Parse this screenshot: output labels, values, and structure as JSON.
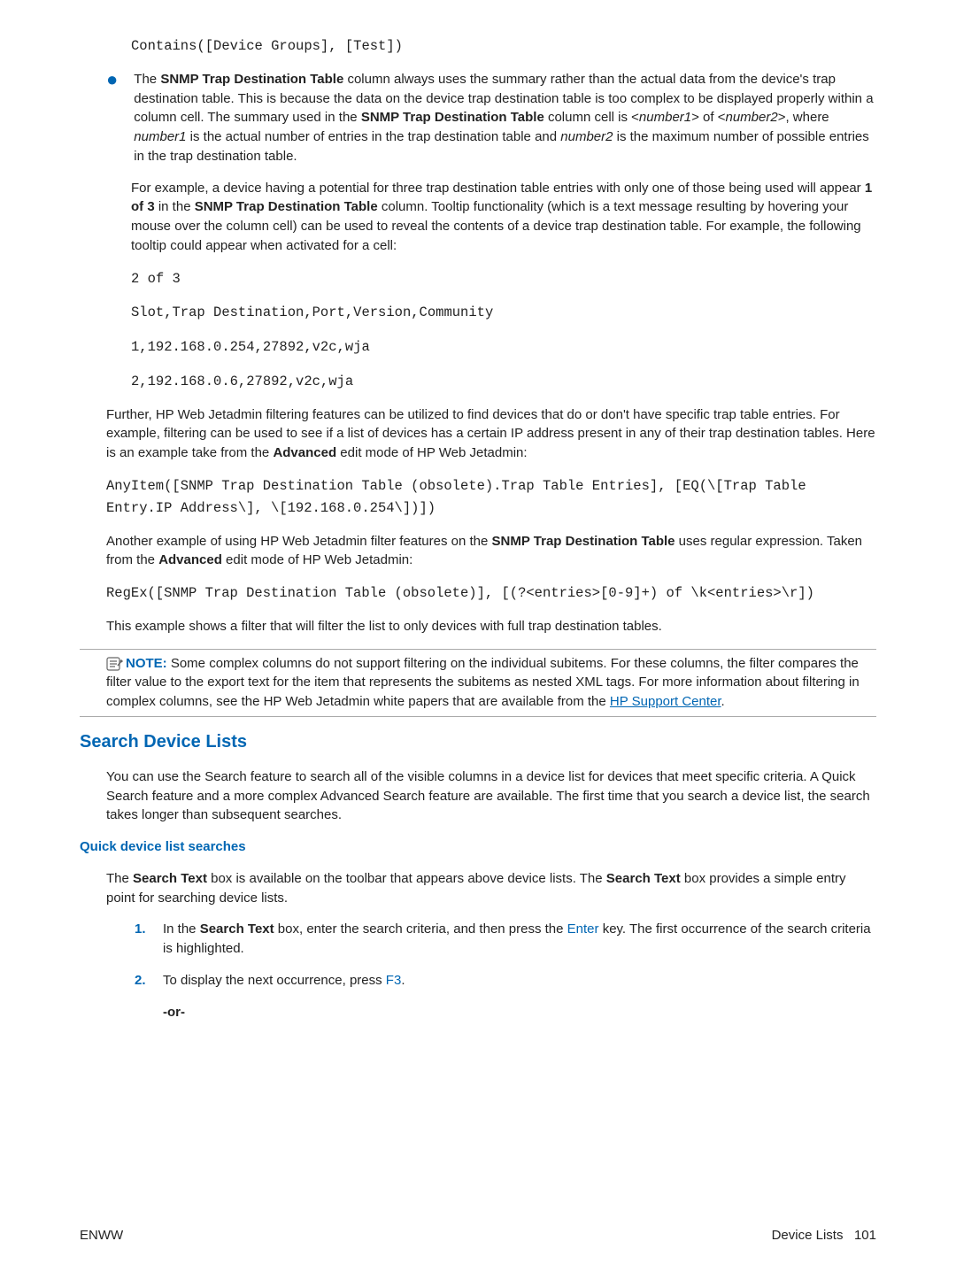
{
  "code_top": "Contains([Device Groups], [Test])",
  "bullet": {
    "p1a": "The ",
    "p1b": "SNMP Trap Destination Table",
    "p1c": " column always uses the summary rather than the actual data from the device's trap destination table. This is because the data on the device trap destination table is too complex to be displayed properly within a column cell. The summary used in the ",
    "p1d": "SNMP Trap Destination Table",
    "p1e": " column cell is <",
    "p1f": "number1",
    "p1g": "> of <",
    "p1h": "number2",
    "p1i": ">, where ",
    "p1j": "number1",
    "p1k": " is the actual number of entries in the trap destination table and ",
    "p1l": "number2",
    "p1m": " is the maximum number of possible entries in the trap destination table.",
    "p2a": "For example, a device having a potential for three trap destination table entries with only one of those being used will appear ",
    "p2b": "1 of 3",
    "p2c": " in the ",
    "p2d": "SNMP Trap Destination Table",
    "p2e": " column. Tooltip functionality (which is a text message resulting by hovering your mouse over the column cell) can be used to reveal the contents of a device trap destination table. For example, the following tooltip could appear when activated for a cell:"
  },
  "tooltip_code": {
    "l1": "2 of 3",
    "l2": "Slot,Trap Destination,Port,Version,Community",
    "l3": "1,192.168.0.254,27892,v2c,wja",
    "l4": "2,192.168.0.6,27892,v2c,wja"
  },
  "p_further": {
    "a": "Further, HP Web Jetadmin filtering features can be utilized to find devices that do or don't have specific trap table entries. For example, filtering can be used to see if a list of devices has a certain IP address present in any of their trap destination tables. Here is an example take from the ",
    "b": "Advanced",
    "c": " edit mode of HP Web Jetadmin:"
  },
  "code_anyitem": "AnyItem([SNMP Trap Destination Table (obsolete).Trap Table Entries], [EQ(\\[Trap Table Entry.IP Address\\], \\[192.168.0.254\\])])",
  "p_another": {
    "a": "Another example of using HP Web Jetadmin filter features on the ",
    "b": "SNMP Trap Destination Table",
    "c": " uses regular expression. Taken from the ",
    "d": "Advanced",
    "e": " edit mode of HP Web Jetadmin:"
  },
  "code_regex": "RegEx([SNMP Trap Destination Table (obsolete)], [(?<entries>[0-9]+) of \\k<entries>\\r])",
  "p_example": "This example shows a filter that will filter the list to only devices with full trap destination tables.",
  "note": {
    "label": "NOTE:",
    "text1": "   Some complex columns do not support filtering on the individual subitems. For these columns, the filter compares the filter value to the export text for the item that represents the subitems as nested XML tags. For more information about filtering in complex columns, see the HP Web Jetadmin white papers that are available from the ",
    "link": "HP Support Center",
    "text2": "."
  },
  "h2": "Search Device Lists",
  "p_search": "You can use the Search feature to search all of the visible columns in a device list for devices that meet specific criteria. A Quick Search feature and a more complex Advanced Search feature are available. The first time that you search a device list, the search takes longer than subsequent searches.",
  "h3": "Quick device list searches",
  "p_quick": {
    "a": "The ",
    "b": "Search Text",
    "c": " box is available on the toolbar that appears above device lists. The ",
    "d": "Search Text",
    "e": " box provides a simple entry point for searching device lists."
  },
  "steps": {
    "n1": "1.",
    "s1a": "In the ",
    "s1b": "Search Text",
    "s1c": " box, enter the search criteria, and then press the ",
    "s1d": "Enter",
    "s1e": " key. The first occurrence of the search criteria is highlighted.",
    "n2": "2.",
    "s2a": "To display the next occurrence, press ",
    "s2b": "F3",
    "s2c": ".",
    "or": "-or-"
  },
  "footer": {
    "left": "ENWW",
    "right_label": "Device Lists",
    "right_page": "101"
  }
}
